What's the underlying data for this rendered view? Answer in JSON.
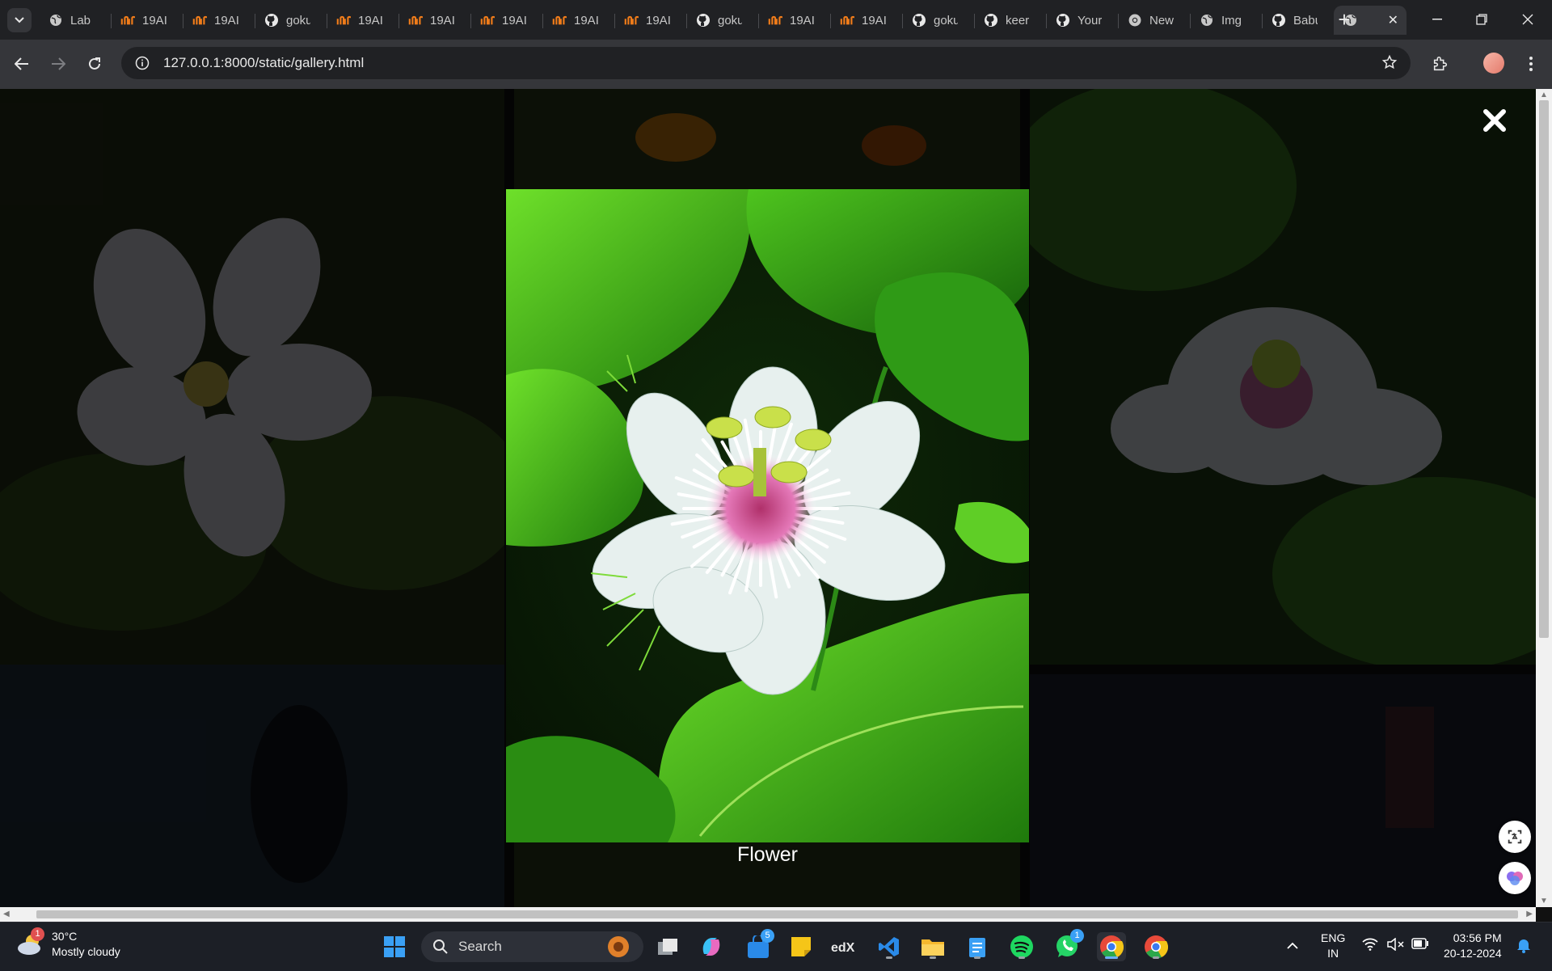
{
  "browser": {
    "tabs": [
      {
        "title": "Lab",
        "icon": "globe-icon"
      },
      {
        "title": "19AI",
        "icon": "tab-19ai-icon"
      },
      {
        "title": "19AI",
        "icon": "tab-19ai-icon"
      },
      {
        "title": "goku",
        "icon": "github-icon"
      },
      {
        "title": "19AI",
        "icon": "tab-19ai-icon"
      },
      {
        "title": "19AI",
        "icon": "tab-19ai-icon"
      },
      {
        "title": "19AI",
        "icon": "tab-19ai-icon"
      },
      {
        "title": "19AI",
        "icon": "tab-19ai-icon"
      },
      {
        "title": "19AI",
        "icon": "tab-19ai-icon"
      },
      {
        "title": "goku",
        "icon": "github-icon"
      },
      {
        "title": "19AI",
        "icon": "tab-19ai-icon"
      },
      {
        "title": "19AI",
        "icon": "tab-19ai-icon"
      },
      {
        "title": "goku",
        "icon": "github-icon"
      },
      {
        "title": "keer",
        "icon": "github-icon"
      },
      {
        "title": "Your",
        "icon": "github-icon"
      },
      {
        "title": "New",
        "icon": "chrome-icon"
      },
      {
        "title": "Img",
        "icon": "globe-icon"
      },
      {
        "title": "Babu",
        "icon": "github-icon"
      },
      {
        "title": "",
        "icon": "globe-icon",
        "active": true
      }
    ],
    "url": "127.0.0.1:8000/static/gallery.html"
  },
  "gallery": {
    "caption": "Flower",
    "close_symbol": "✖"
  },
  "taskbar": {
    "weather_temp": "30°C",
    "weather_desc": "Mostly cloudy",
    "weather_badge": "1",
    "search_label": "Search",
    "store_badge": "5",
    "whatsapp_badge": "1",
    "lang_line1": "ENG",
    "lang_line2": "IN",
    "time": "03:56 PM",
    "date": "20-12-2024"
  },
  "colors": {
    "accent_19ai": "#f07c1a",
    "leaf_green": "#3fbf1a",
    "chrome_dark": "#202124"
  }
}
